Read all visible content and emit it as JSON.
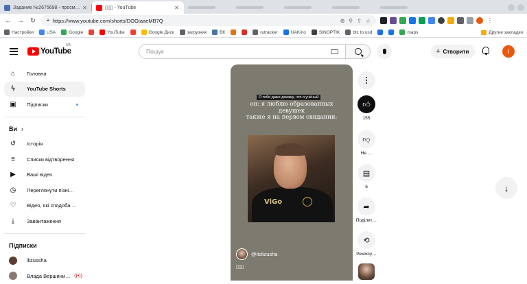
{
  "browser": {
    "tabs": [
      {
        "title": "Задание №2675698 - просмотр з",
        "favicon_color": "#4a6fb5"
      },
      {
        "title": "▯▯▯ - YouTube",
        "favicon_color": "#ff0000"
      }
    ],
    "url": "https://www.youtube.com/shorts/DOGtaaeMB7Q",
    "bookmarks": [
      {
        "label": "Настройки",
        "color": "#5f6368"
      },
      {
        "label": "USA",
        "color": "#4285f4"
      },
      {
        "label": "Google",
        "color": "#34a853"
      },
      {
        "label": "",
        "color": "#ea4335"
      },
      {
        "label": "YouTube",
        "color": "#ff0000"
      },
      {
        "label": "",
        "color": "#ea4335"
      },
      {
        "label": "Google Диск",
        "color": "#fbbc04"
      },
      {
        "label": "загрузчик",
        "color": "#5f6368"
      },
      {
        "label": "ВК",
        "color": "#4a76a8"
      },
      {
        "label": "",
        "color": "#e8710a"
      },
      {
        "label": "",
        "color": "#d93025"
      },
      {
        "label": "rutracker",
        "color": "#5f6368"
      },
      {
        "label": "UAKino",
        "color": "#1a73e8"
      },
      {
        "label": "SINOPTIK",
        "color": "#3c4043"
      },
      {
        "label": "btc to usd",
        "color": "#5f6368"
      },
      {
        "label": "",
        "color": "#1a73e8"
      },
      {
        "label": "",
        "color": "#1a73e8"
      },
      {
        "label": "maps",
        "color": "#34a853"
      }
    ],
    "other_bookmarks": "Другие закладки"
  },
  "header": {
    "logo_text": "YouTube",
    "logo_region": "UA",
    "search_placeholder": "Пошук",
    "create_label": "Створити",
    "avatar_letter": "I"
  },
  "sidebar": {
    "items": [
      {
        "label": "Головна",
        "icon": "home-icon",
        "glyph": "⌂"
      },
      {
        "label": "YouTube Shorts",
        "icon": "shorts-icon",
        "glyph": "ϟ",
        "active": true
      },
      {
        "label": "Підписки",
        "icon": "subscriptions-icon",
        "glyph": "▣"
      }
    ],
    "you_heading": "Ви",
    "you_items": [
      {
        "label": "Історія",
        "icon": "history-icon",
        "glyph": "↺"
      },
      {
        "label": "Списки відтворення",
        "icon": "playlists-icon",
        "glyph": "≡"
      },
      {
        "label": "Ваші відео",
        "icon": "your-videos-icon",
        "glyph": "▶"
      },
      {
        "label": "Переглянути пізні…",
        "icon": "watch-later-icon",
        "glyph": "◷"
      },
      {
        "label": "Відео, які сподоба…",
        "icon": "liked-icon",
        "glyph": "👍"
      },
      {
        "label": "Завантаження",
        "icon": "download-icon",
        "glyph": "⤓"
      }
    ],
    "subs_heading": "Підписки",
    "subs": [
      {
        "label": "llizussha",
        "color": "#5a3d33",
        "live": false
      },
      {
        "label": "Влада Вершини…",
        "color": "#8a7a70",
        "live": true
      }
    ]
  },
  "short": {
    "caption_top": "Я тебе даже докажу, что я учёный",
    "caption_lines": [
      "он: я люблю образованных",
      "девушек",
      "также я на первом свидании:"
    ],
    "brand_text": "ViGo",
    "channel": "@itslizusha",
    "title": "▯▯▯"
  },
  "actions": {
    "like_count": "155",
    "dislike_label": "Не …",
    "comments_count": "6",
    "share_label": "Поділит…",
    "remix_label": "Реміксу…"
  }
}
